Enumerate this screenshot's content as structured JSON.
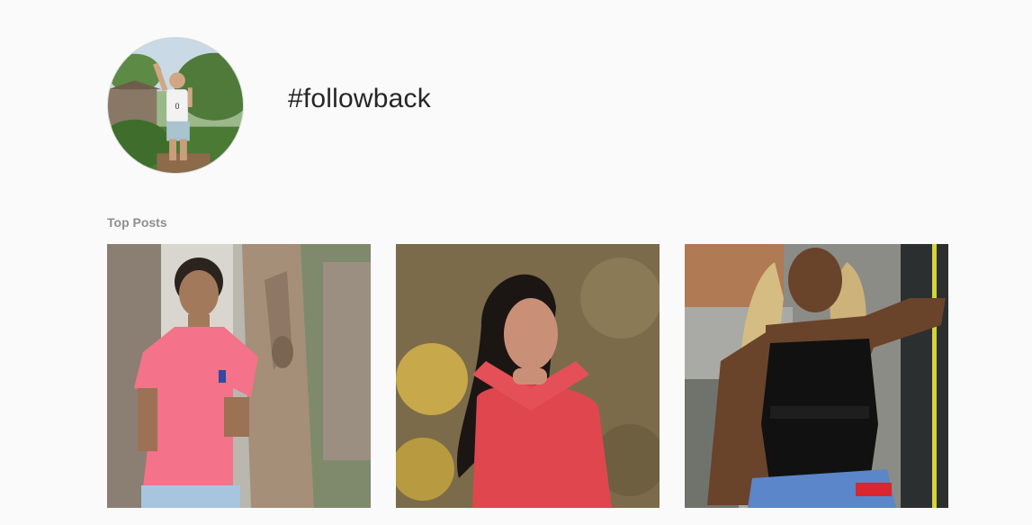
{
  "header": {
    "hashtag": "#followback",
    "avatar_icon": "profile-photo"
  },
  "top_posts": {
    "label": "Top Posts",
    "posts": [
      {
        "subject": "young man in pink polo shirt leaning on tree"
      },
      {
        "subject": "young woman in red top posing with hands under chin"
      },
      {
        "subject": "woman with long blonde braids in black top at street festival"
      }
    ]
  },
  "colors": {
    "background": "#fafafa",
    "title": "#262626",
    "label": "#8e8e8e",
    "avatar_border": "#dbdbdb"
  }
}
